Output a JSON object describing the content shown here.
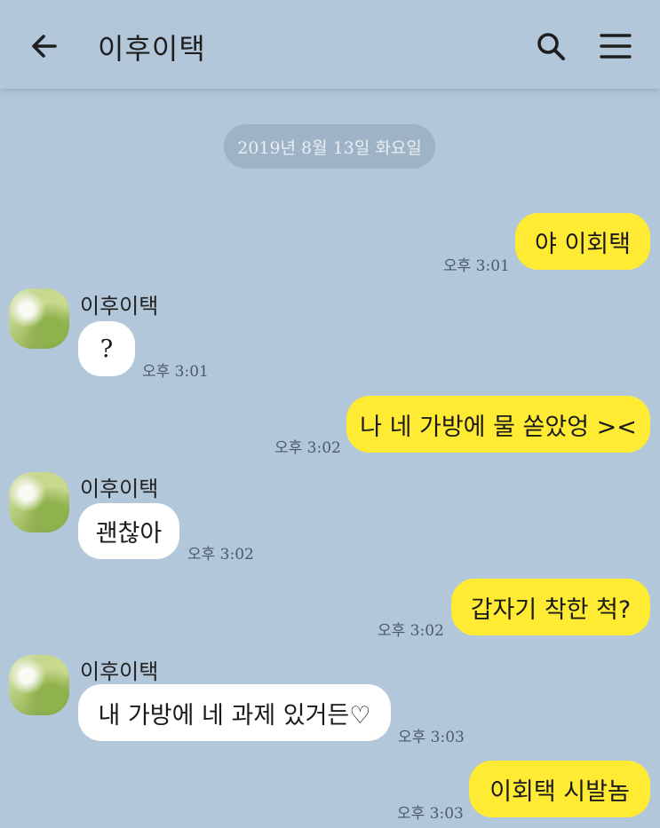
{
  "header": {
    "title": "이후이택",
    "back_icon": "arrow-left-icon",
    "search_icon": "search-icon",
    "menu_icon": "hamburger-menu-icon"
  },
  "date_divider": "2019년 8월 13일 화요일",
  "colors": {
    "background": "#b2c7da",
    "outgoing_bubble": "#ffeb33",
    "incoming_bubble": "#ffffff"
  },
  "messages": [
    {
      "direction": "outgoing",
      "text": "야 이회택",
      "time": "오후 3:01"
    },
    {
      "direction": "incoming",
      "sender": "이후이택",
      "text": "?",
      "time": "오후 3:01"
    },
    {
      "direction": "outgoing",
      "text": "나 네 가방에 물 쏟았엉 ><",
      "time": "오후 3:02"
    },
    {
      "direction": "incoming",
      "sender": "이후이택",
      "text": "괜찮아",
      "time": "오후 3:02"
    },
    {
      "direction": "outgoing",
      "text": "갑자기 착한 척?",
      "time": "오후 3:02"
    },
    {
      "direction": "incoming",
      "sender": "이후이택",
      "text": "내 가방에 네 과제 있거든♡",
      "time": "오후 3:03"
    },
    {
      "direction": "outgoing",
      "text": "이회택 시발놈",
      "time": "오후 3:03"
    }
  ]
}
